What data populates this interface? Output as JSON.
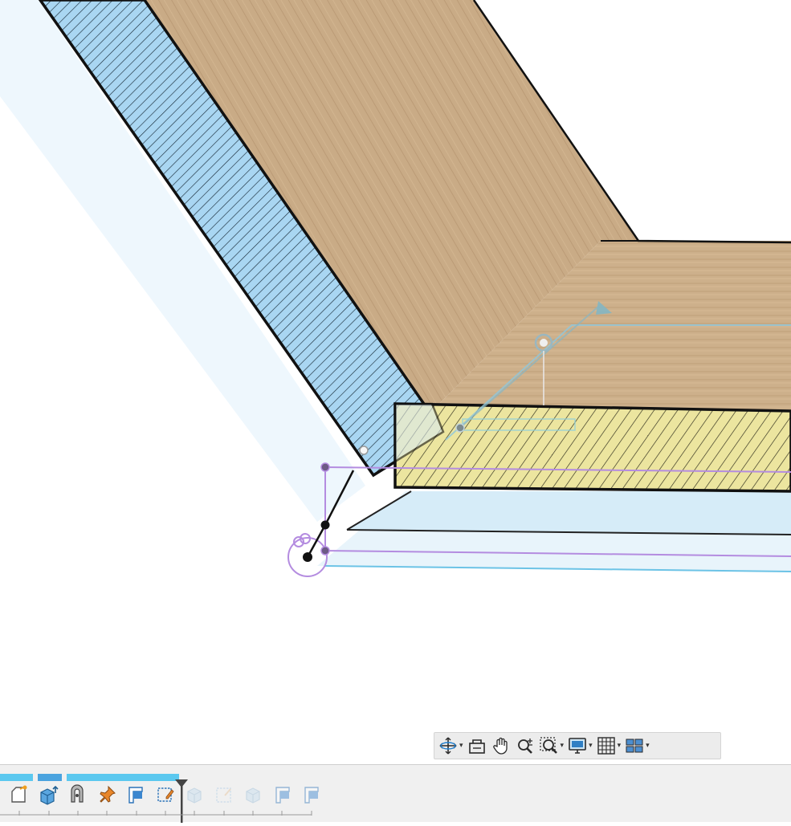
{
  "viewport": {
    "background": "#ffffff",
    "colors": {
      "wood": "#c9ab86",
      "wood_dark": "#b69470",
      "hatch_blue": "#a9d6f2",
      "hatch_yellow": "#ece59f",
      "edge": "#111111",
      "sketch_purple": "#b48ce0",
      "sketch_cyan": "#6cc3e6",
      "ghost_blue": "#eef7fd"
    }
  },
  "nav_toolbar": {
    "items": [
      {
        "icon": "orbit-icon",
        "has_menu": true
      },
      {
        "icon": "look-at-icon",
        "has_menu": false
      },
      {
        "icon": "pan-hand-icon",
        "has_menu": false
      },
      {
        "icon": "zoom-icon",
        "has_menu": false
      },
      {
        "icon": "zoom-window-icon",
        "has_menu": true
      },
      {
        "icon": "display-settings-icon",
        "has_menu": true
      },
      {
        "icon": "grid-icon",
        "has_menu": true
      },
      {
        "icon": "viewports-icon",
        "has_menu": true
      }
    ]
  },
  "timeline": {
    "items": [
      {
        "icon": "sketch-icon",
        "state": "active"
      },
      {
        "icon": "extrude-icon",
        "state": "active"
      },
      {
        "icon": "joint-icon",
        "state": "active"
      },
      {
        "icon": "pin-icon",
        "state": "active"
      },
      {
        "icon": "construction-plane-icon",
        "state": "active"
      },
      {
        "icon": "sketch-edit-icon",
        "state": "active"
      },
      {
        "icon": "body-icon",
        "state": "suppressed"
      },
      {
        "icon": "sketch-dashed-icon",
        "state": "suppressed"
      },
      {
        "icon": "body-icon",
        "state": "suppressed"
      },
      {
        "icon": "construction-plane-icon",
        "state": "suppressed"
      },
      {
        "icon": "construction-plane-icon",
        "state": "suppressed"
      }
    ],
    "colors": {
      "group_bar": "#5bc8ef",
      "selected_bar": "#4aa3df",
      "marker": "#444444"
    }
  }
}
